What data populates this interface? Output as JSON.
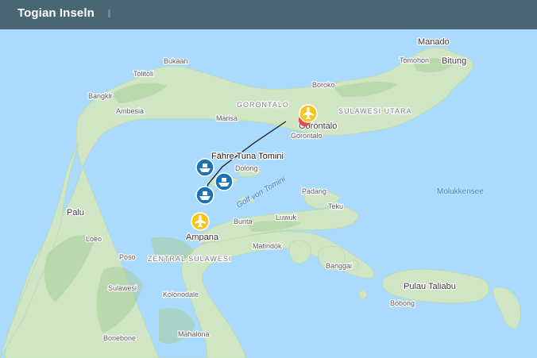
{
  "header": {
    "title": "Togian Inseln"
  },
  "map": {
    "colors": {
      "water": "#aadaff",
      "land": "#cfe5c4",
      "land_dark": "#a9cf9b",
      "route": "#1a1a1a",
      "airport": "#f5c518",
      "ferry": "#1a73b8",
      "marker_red": "#e8474f"
    },
    "labels": {
      "manado": "Manado",
      "bitung": "Bitung",
      "tomohon": "Tomohon",
      "bukaan": "Bukaan",
      "tolitoli": "Tolitoli",
      "boroko": "Boroko",
      "bangkir": "Bangkir",
      "ambesia": "Ambesia",
      "gorontalo_region": "GORONTALO",
      "sulawesi_utara": "SULAWESI UTARA",
      "marisa": "Marisa",
      "gorontalo_city": "Gorontalo",
      "gorontalo_airport": "Gorontalo",
      "faehre": "Fähre Tuna Tomini",
      "dolong": "Dolong",
      "golf": "Golf von Tomini",
      "padang": "Padang",
      "molukkensee": "Molukkensee",
      "palu": "Palu",
      "teku": "Teku",
      "luwuk": "Luwuk",
      "bunta": "Bunta",
      "ampana": "Ampana",
      "loeo": "Loeo",
      "matindok": "Matindok",
      "poso": "Poso",
      "zentral": "ZENTRAL SULAWESI",
      "banggai": "Banggai",
      "pulau_taliabu": "Pulau Taliabu",
      "bobong": "Bobong",
      "sulawesi": "Sulawesi",
      "kolonodale": "Kolonodale",
      "bonebone": "Bonebone",
      "mahalona": "Mahalona"
    },
    "markers": [
      {
        "name": "airport-gorontalo",
        "icon": "airplane-icon"
      },
      {
        "name": "airport-ampana",
        "icon": "airplane-icon"
      },
      {
        "name": "ferry-1",
        "icon": "ferry-icon"
      },
      {
        "name": "ferry-2",
        "icon": "ferry-icon"
      },
      {
        "name": "ferry-3",
        "icon": "ferry-icon"
      }
    ]
  }
}
